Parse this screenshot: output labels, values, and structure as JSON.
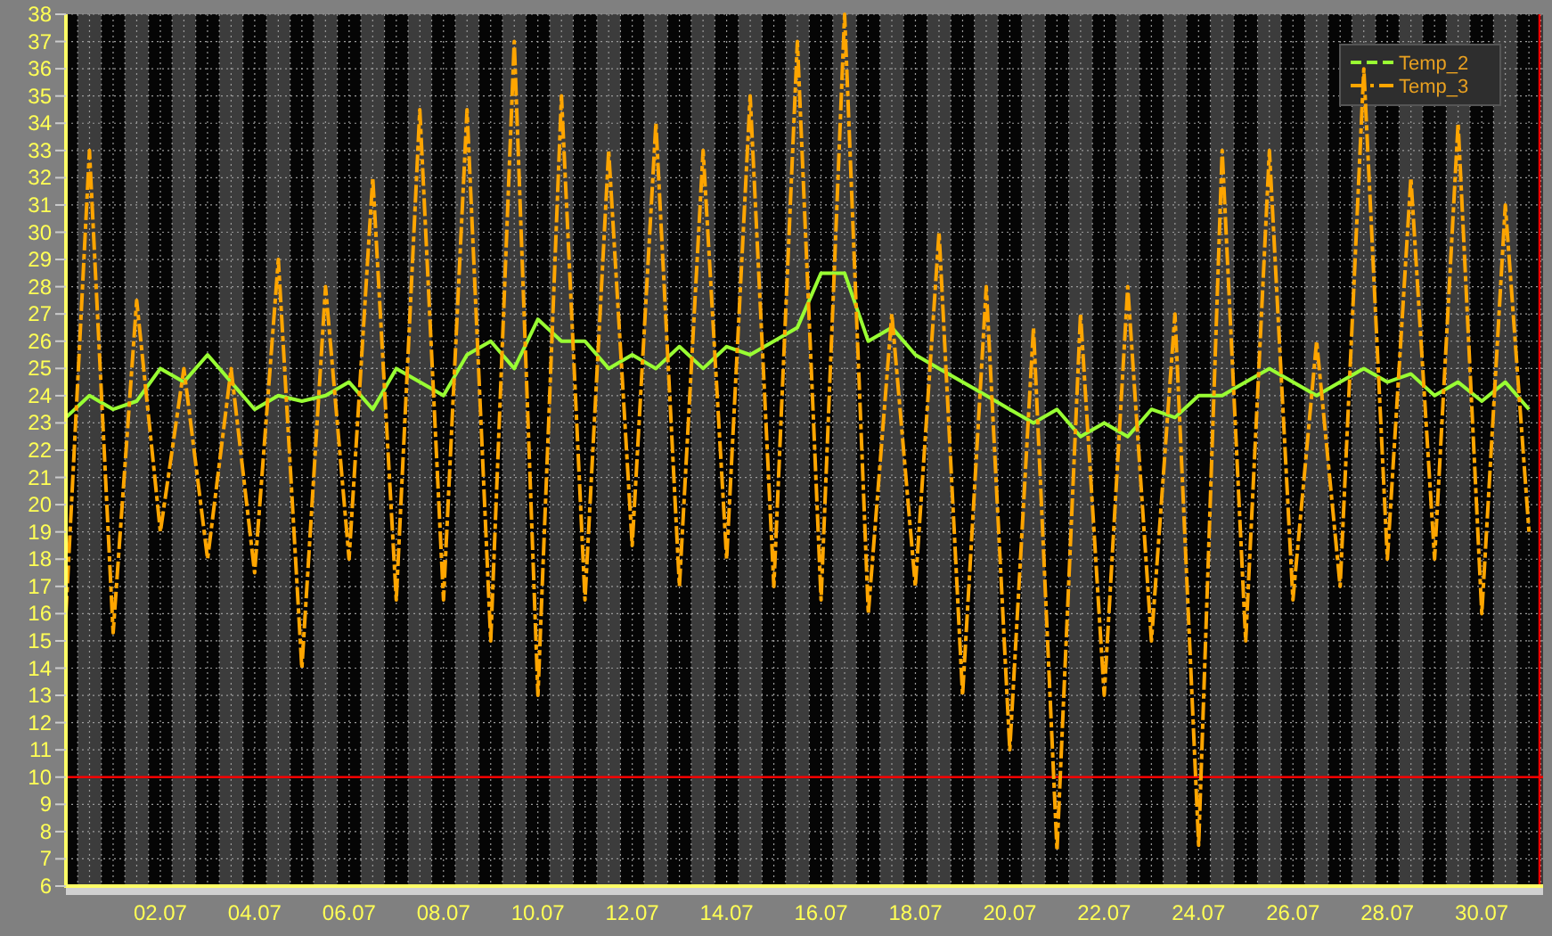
{
  "chart": {
    "chart_data": {
      "type": "line",
      "categories": [
        null,
        null,
        null,
        null,
        "02.07",
        null,
        null,
        null,
        "04.07",
        null,
        null,
        null,
        "06.07",
        null,
        null,
        null,
        "08.07",
        null,
        null,
        null,
        "10.07",
        null,
        null,
        null,
        "12.07",
        null,
        null,
        null,
        "14.07",
        null,
        null,
        null,
        "16.07",
        null,
        null,
        null,
        "18.07",
        null,
        null,
        null,
        "20.07",
        null,
        null,
        null,
        "22.07",
        null,
        null,
        null,
        "24.07",
        null,
        null,
        null,
        "26.07",
        null,
        null,
        null,
        "28.07",
        null,
        null,
        null,
        "30.07",
        null,
        null
      ],
      "series": [
        {
          "name": "Temp_2",
          "color": "#99ff33",
          "line_style": "solid",
          "values": [
            23.2,
            24,
            23.5,
            23.8,
            25,
            24.5,
            25.5,
            24.5,
            23.5,
            24,
            23.8,
            24,
            24.5,
            23.5,
            25,
            24.5,
            24,
            25.5,
            26,
            25,
            26.8,
            26,
            26,
            25,
            25.5,
            25,
            25.8,
            25,
            25.8,
            25.5,
            26,
            26.5,
            28.5,
            28.5,
            26,
            26.5,
            25.5,
            25,
            24.5,
            24,
            23.5,
            23,
            23.5,
            22.5,
            23,
            22.5,
            23.5,
            23.2,
            24,
            24,
            24.5,
            25,
            24.5,
            24,
            24.5,
            25,
            24.5,
            24.8,
            24,
            24.5,
            23.8,
            24.5,
            23.5
          ]
        },
        {
          "name": "Temp_3",
          "color": "#ffa500",
          "line_style": "dashdot",
          "values": [
            16,
            33,
            15.3,
            27.5,
            19,
            25,
            18,
            25,
            17.5,
            29,
            14,
            28,
            18,
            32,
            16.5,
            34.5,
            16.5,
            34.5,
            15,
            37,
            13,
            35,
            16.5,
            33,
            18.5,
            34,
            17,
            33,
            18,
            35,
            17,
            37,
            16.5,
            38,
            16,
            27,
            17,
            30,
            13,
            28,
            11,
            26.5,
            7.3,
            27,
            13,
            28,
            15,
            27,
            7.5,
            33,
            15,
            33,
            16.5,
            26,
            17,
            36,
            18,
            32,
            18,
            34,
            16,
            31,
            19
          ]
        }
      ],
      "ylim": [
        6,
        38
      ],
      "yticks": [
        6,
        7,
        8,
        9,
        10,
        11,
        12,
        13,
        14,
        15,
        16,
        17,
        18,
        19,
        20,
        21,
        22,
        23,
        24,
        25,
        26,
        27,
        28,
        29,
        30,
        31,
        32,
        33,
        34,
        35,
        36,
        37,
        38
      ],
      "ref_lines": [
        {
          "axis": "y",
          "value": 10,
          "color": "#ff0000"
        }
      ],
      "grid": true,
      "legend": true
    }
  }
}
